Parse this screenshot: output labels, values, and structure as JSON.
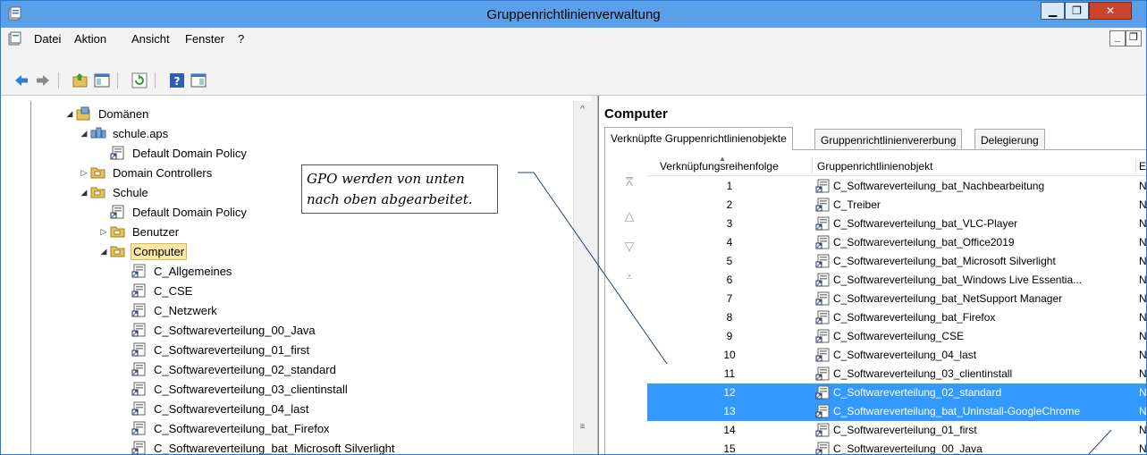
{
  "window": {
    "title": "Gruppenrichtlinienverwaltung"
  },
  "menubar": {
    "items": [
      "Datei",
      "Aktion",
      "Ansicht",
      "Fenster",
      "?"
    ]
  },
  "tree": [
    {
      "label": "Domänen",
      "expander": "◢",
      "icon": "domains-icon"
    },
    {
      "label": "schule.aps",
      "expander": "◢",
      "icon": "domain-icon"
    },
    {
      "label": "Default Domain Policy",
      "expander": "",
      "icon": "gpo-link-icon"
    },
    {
      "label": "Domain Controllers",
      "expander": "▷",
      "icon": "folder-icon"
    },
    {
      "label": "Schule",
      "expander": "◢",
      "icon": "folder-icon"
    },
    {
      "label": "Default Domain Policy",
      "expander": "",
      "icon": "gpo-link-icon"
    },
    {
      "label": "Benutzer",
      "expander": "▷",
      "icon": "folder-icon"
    },
    {
      "label": "Computer",
      "expander": "◢",
      "icon": "folder-icon"
    },
    {
      "label": "C_Allgemeines",
      "expander": "",
      "icon": "gpo-link-icon"
    },
    {
      "label": "C_CSE",
      "expander": "",
      "icon": "gpo-link-icon"
    },
    {
      "label": "C_Netzwerk",
      "expander": "",
      "icon": "gpo-link-icon"
    },
    {
      "label": "C_Softwareverteilung_00_Java",
      "expander": "",
      "icon": "gpo-link-icon"
    },
    {
      "label": "C_Softwareverteilung_01_first",
      "expander": "",
      "icon": "gpo-link-icon"
    },
    {
      "label": "C_Softwareverteilung_02_standard",
      "expander": "",
      "icon": "gpo-link-icon"
    },
    {
      "label": "C_Softwareverteilung_03_clientinstall",
      "expander": "",
      "icon": "gpo-link-icon"
    },
    {
      "label": "C_Softwareverteilung_04_last",
      "expander": "",
      "icon": "gpo-link-icon"
    },
    {
      "label": "C_Softwareverteilung_bat_Firefox",
      "expander": "",
      "icon": "gpo-link-icon"
    },
    {
      "label": "C_Softwareverteilung_bat_Microsoft Silverlight",
      "expander": "",
      "icon": "gpo-link-icon"
    }
  ],
  "right": {
    "title": "Computer",
    "tabs": [
      "Verknüpfte Gruppenrichtlinienobjekte",
      "Gruppenrichtlinienvererbung",
      "Delegierung"
    ],
    "columns": [
      "Verknüpfungsreihenfolge",
      "Gruppenrichtlinienobjekt",
      "E"
    ],
    "rows": [
      {
        "order": "1",
        "name": "C_Softwareverteilung_bat_Nachbearbeitung",
        "e": "N"
      },
      {
        "order": "2",
        "name": "C_Treiber",
        "e": "N"
      },
      {
        "order": "3",
        "name": "C_Softwareverteilung_bat_VLC-Player",
        "e": "N"
      },
      {
        "order": "4",
        "name": "C_Softwareverteilung_bat_Office2019",
        "e": "N"
      },
      {
        "order": "5",
        "name": "C_Softwareverteilung_bat_Microsoft Silverlight",
        "e": "N"
      },
      {
        "order": "6",
        "name": "C_Softwareverteilung_bat_Windows Live Essentia...",
        "e": "N"
      },
      {
        "order": "7",
        "name": "C_Softwareverteilung_bat_NetSupport Manager",
        "e": "N"
      },
      {
        "order": "8",
        "name": "C_Softwareverteilung_bat_Firefox",
        "e": "N"
      },
      {
        "order": "9",
        "name": "C_Softwareverteilung_CSE",
        "e": "N"
      },
      {
        "order": "10",
        "name": "C_Softwareverteilung_04_last",
        "e": "N"
      },
      {
        "order": "11",
        "name": "C_Softwareverteilung_03_clientinstall",
        "e": "N"
      },
      {
        "order": "12",
        "name": "C_Softwareverteilung_02_standard",
        "e": "N",
        "selected": true
      },
      {
        "order": "13",
        "name": "C_Softwareverteilung_bat_Uninstall-GoogleChrome",
        "e": "N",
        "selected": true
      },
      {
        "order": "14",
        "name": "C_Softwareverteilung_01_first",
        "e": "N"
      },
      {
        "order": "15",
        "name": "C_Softwareverteilung_00_Java",
        "e": "N"
      }
    ]
  },
  "annotation": {
    "line1": "GPO werden von unten",
    "line2": "nach oben abgearbeitet."
  },
  "colors": {
    "titlebar": "#5aa0e8",
    "selection": "#3399ff",
    "tree_selection": "#fbe7a6"
  }
}
